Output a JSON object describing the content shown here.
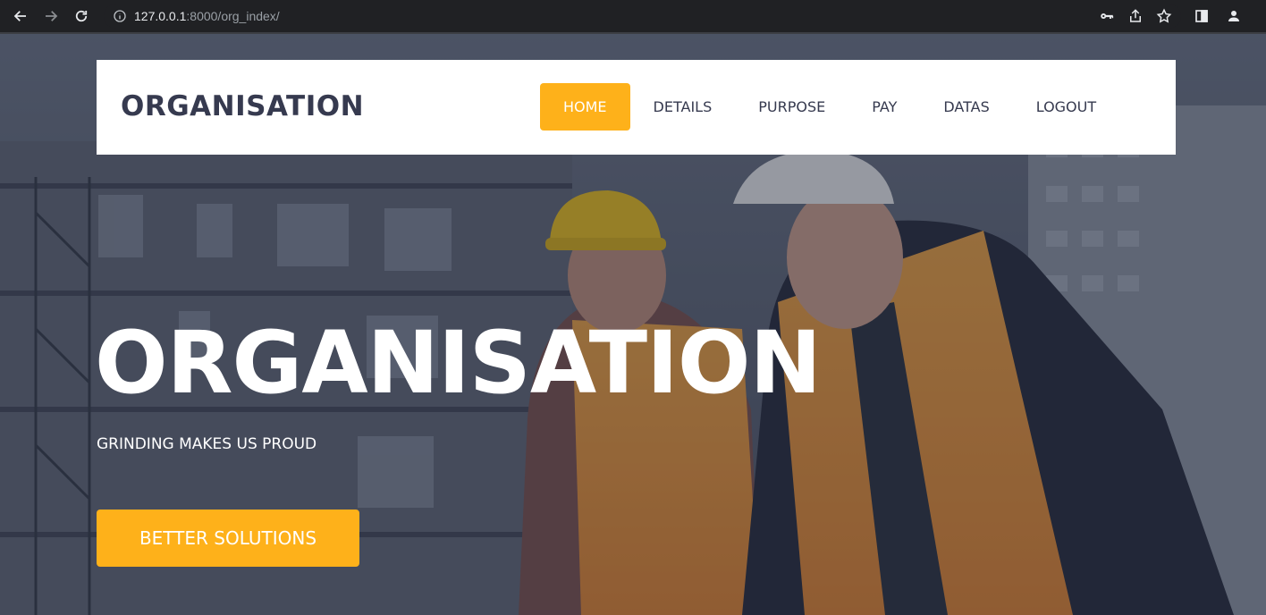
{
  "browser": {
    "url_host": "127.0.0.1",
    "url_rest": ":8000/org_index/",
    "icons": [
      "back-icon",
      "forward-icon",
      "reload-icon",
      "info-icon",
      "key-icon",
      "share-icon",
      "star-icon",
      "side-panel-icon",
      "profile-icon"
    ]
  },
  "header": {
    "logo": "ORGANISATION",
    "nav": [
      {
        "label": "HOME",
        "active": true
      },
      {
        "label": "DETAILS",
        "active": false
      },
      {
        "label": "PURPOSE",
        "active": false
      },
      {
        "label": "PAY",
        "active": false
      },
      {
        "label": "DATAS",
        "active": false
      },
      {
        "label": "LOGOUT",
        "active": false
      }
    ]
  },
  "hero": {
    "title": "ORGANISATION",
    "subtitle": "GRINDING MAKES US PROUD",
    "cta_label": "BETTER SOLUTIONS"
  },
  "colors": {
    "accent": "#feb11a",
    "dark_text": "#363a4f",
    "header_bg": "#ffffff"
  }
}
